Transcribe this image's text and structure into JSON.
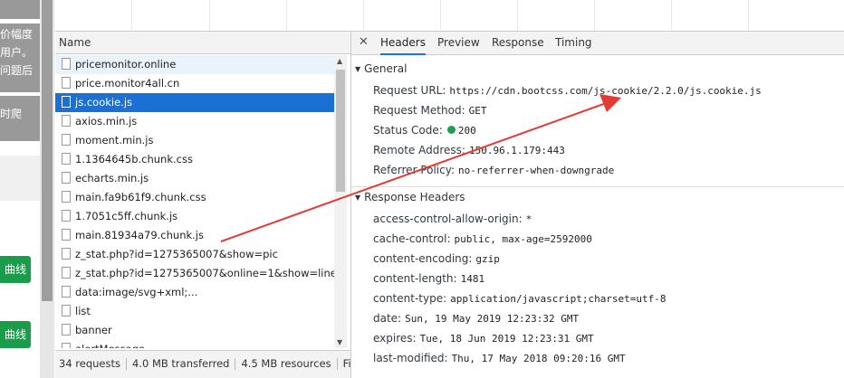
{
  "left_page": {
    "fragments": [
      "价幅度",
      "用户。",
      "问题后",
      "时爬"
    ],
    "green_buttons": [
      "曲线",
      "曲线"
    ]
  },
  "network": {
    "name_header": "Name",
    "files": [
      "pricemonitor.online",
      "price.monitor4all.cn",
      "js.cookie.js",
      "axios.min.js",
      "moment.min.js",
      "1.1364645b.chunk.css",
      "echarts.min.js",
      "main.fa9b61f9.chunk.css",
      "1.7051c5ff.chunk.js",
      "main.81934a79.chunk.js",
      "z_stat.php?id=1275365007&show=pic",
      "z_stat.php?id=1275365007&online=1&show=line",
      "data:image/svg+xml;...",
      "list",
      "banner",
      "alertMessage"
    ],
    "status": {
      "requests": "34 requests",
      "transferred": "4.0 MB transferred",
      "resources": "4.5 MB resources",
      "finish": "Fin..."
    }
  },
  "detail": {
    "tabs": [
      "Headers",
      "Preview",
      "Response",
      "Timing"
    ],
    "general": {
      "title": "General",
      "request_url_label": "Request URL:",
      "request_url": "https://cdn.bootcss.com/js-cookie/2.2.0/js.cookie.js",
      "method_label": "Request Method:",
      "method": "GET",
      "status_label": "Status Code:",
      "status": "200",
      "remote_label": "Remote Address:",
      "remote": "150.96.1.179:443",
      "referrer_label": "Referrer Policy:",
      "referrer": "no-referrer-when-downgrade"
    },
    "response_headers": {
      "title": "Response Headers",
      "items": [
        {
          "k": "access-control-allow-origin:",
          "v": "*"
        },
        {
          "k": "cache-control:",
          "v": "public, max-age=2592000"
        },
        {
          "k": "content-encoding:",
          "v": "gzip"
        },
        {
          "k": "content-length:",
          "v": "1481"
        },
        {
          "k": "content-type:",
          "v": "application/javascript;charset=utf-8"
        },
        {
          "k": "date:",
          "v": "Sun, 19 May 2019 12:23:32 GMT"
        },
        {
          "k": "expires:",
          "v": "Tue, 18 Jun 2019 12:23:31 GMT"
        },
        {
          "k": "last-modified:",
          "v": "Thu, 17 May 2018 09:20:16 GMT"
        }
      ]
    }
  },
  "colors": {
    "selection": "#1b70d4",
    "annotation_arrow": "#e53935",
    "status_ok": "#1aa24a"
  }
}
